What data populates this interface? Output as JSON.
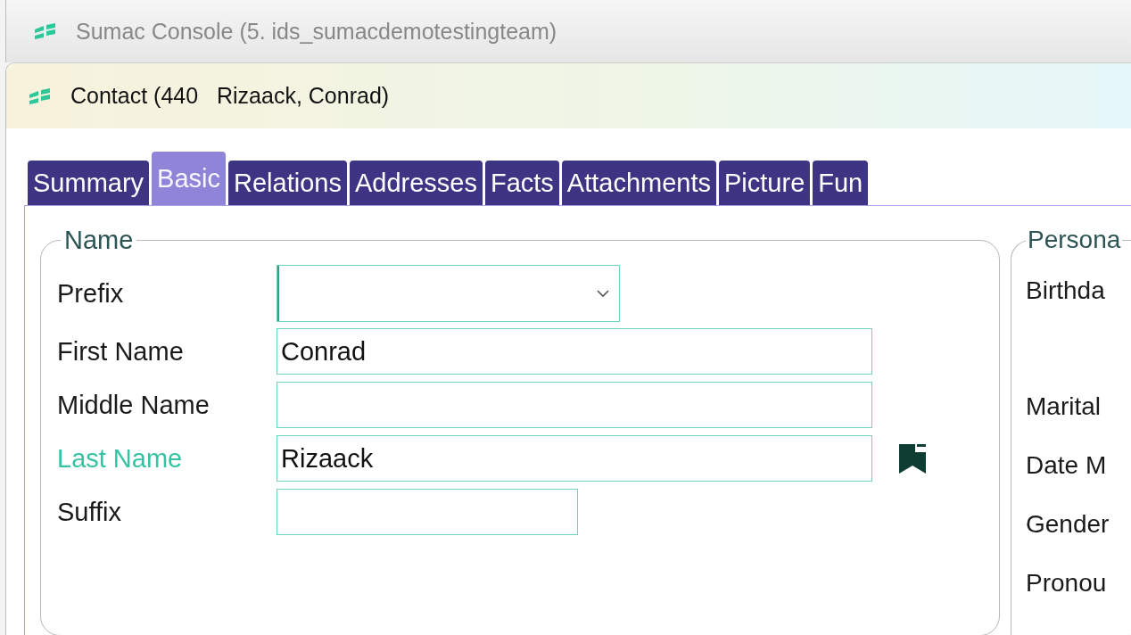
{
  "outer_window": {
    "title": "Sumac Console (5. ids_sumacdemotestingteam)"
  },
  "window": {
    "title": "Contact (440   Rizaack, Conrad)"
  },
  "tabs": [
    {
      "label": "Summary",
      "selected": false
    },
    {
      "label": "Basic",
      "selected": true
    },
    {
      "label": "Relations",
      "selected": false
    },
    {
      "label": "Addresses",
      "selected": false
    },
    {
      "label": "Facts",
      "selected": false
    },
    {
      "label": "Attachments",
      "selected": false
    },
    {
      "label": "Picture",
      "selected": false
    },
    {
      "label": "Fun",
      "selected": false
    }
  ],
  "name_group": {
    "title": "Name",
    "fields": [
      {
        "label": "Prefix",
        "kind": "dropdown",
        "emphasized": false,
        "bookmark": false
      },
      {
        "label": "First Name",
        "kind": "text",
        "value": "Conrad",
        "emphasized": false,
        "bookmark": false
      },
      {
        "label": "Middle Name",
        "kind": "text",
        "emphasized": false,
        "bookmark": false
      },
      {
        "label": "Last Name",
        "kind": "text",
        "value": "Rizaack",
        "emphasized": true,
        "bookmark": true
      },
      {
        "label": "Suffix",
        "kind": "short",
        "emphasized": false,
        "bookmark": false
      }
    ]
  },
  "personal_group": {
    "title": "Persona",
    "labels": [
      "Birthda",
      "Marital",
      "Date M",
      "Gender",
      "Pronou"
    ]
  }
}
